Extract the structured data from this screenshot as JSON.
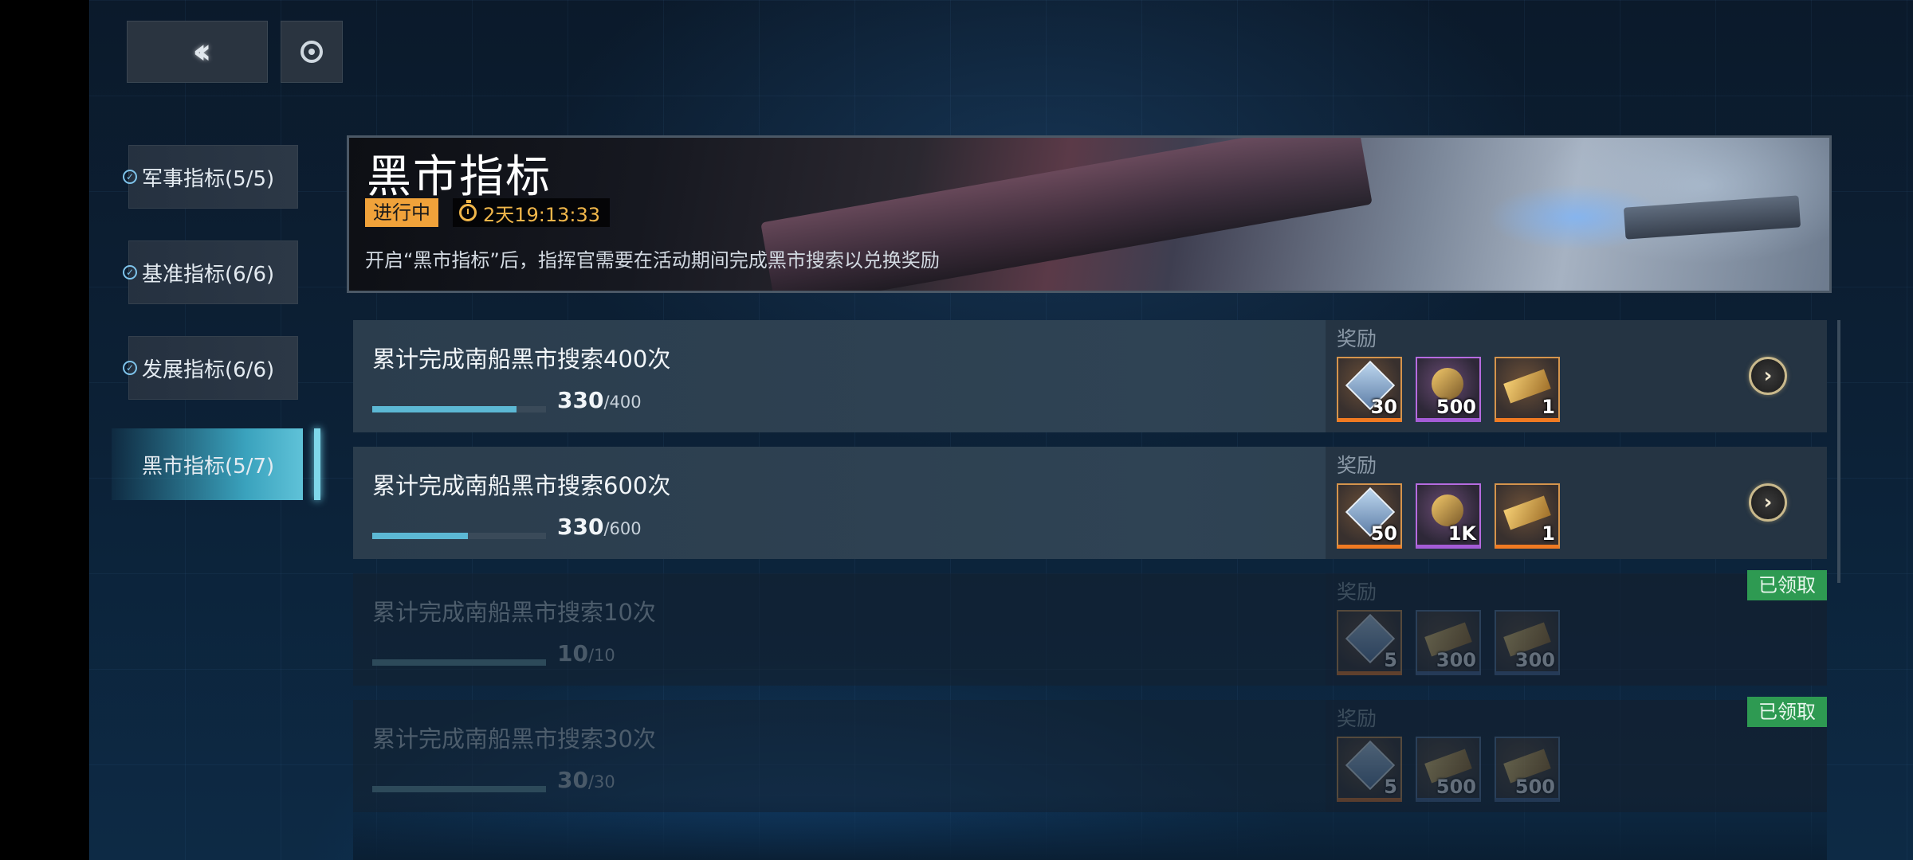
{
  "nav": {
    "back_icon": "double-chevron-left-icon",
    "refresh_icon": "refresh-ring-icon"
  },
  "sidebar": {
    "items": [
      {
        "label": "军事指标(5/5)",
        "checked": true,
        "active": false
      },
      {
        "label": "基准指标(6/6)",
        "checked": true,
        "active": false
      },
      {
        "label": "发展指标(6/6)",
        "checked": true,
        "active": false
      },
      {
        "label": "黑市指标(5/7)",
        "checked": false,
        "active": true
      }
    ]
  },
  "banner": {
    "title": "黑市指标",
    "status": "进行中",
    "timer": "2天19:13:33",
    "description": "开启“黑市指标”后，指挥官需要在活动期间完成黑市搜索以兑换奖励"
  },
  "reward_label": "奖励",
  "claimed_label": "已领取",
  "tasks": [
    {
      "title": "累计完成南船黑市搜索400次",
      "progress": "330",
      "progress_max": "/400",
      "fraction": 0.825,
      "state": "in_progress",
      "rewards": [
        {
          "icon": "gem-chip-icon",
          "count": "30",
          "rarity": "orange"
        },
        {
          "icon": "gold-ore-icon",
          "count": "500",
          "rarity": "purple"
        },
        {
          "icon": "cannon-part-icon",
          "count": "1",
          "rarity": "orange"
        }
      ]
    },
    {
      "title": "累计完成南船黑市搜索600次",
      "progress": "330",
      "progress_max": "/600",
      "fraction": 0.55,
      "state": "in_progress",
      "rewards": [
        {
          "icon": "gem-chip-icon",
          "count": "50",
          "rarity": "orange"
        },
        {
          "icon": "gold-ore-icon",
          "count": "1K",
          "rarity": "purple"
        },
        {
          "icon": "cannon-part-icon",
          "count": "1",
          "rarity": "orange"
        }
      ]
    },
    {
      "title": "累计完成南船黑市搜索10次",
      "progress": "10",
      "progress_max": "/10",
      "fraction": 1.0,
      "state": "claimed",
      "rewards": [
        {
          "icon": "gem-chip-icon",
          "count": "5",
          "rarity": "orange"
        },
        {
          "icon": "ore-icon",
          "count": "300",
          "rarity": "blue"
        },
        {
          "icon": "alloy-icon",
          "count": "300",
          "rarity": "blue"
        }
      ]
    },
    {
      "title": "累计完成南船黑市搜索30次",
      "progress": "30",
      "progress_max": "/30",
      "fraction": 1.0,
      "state": "claimed",
      "rewards": [
        {
          "icon": "gem-chip-icon",
          "count": "5",
          "rarity": "orange"
        },
        {
          "icon": "ore-icon",
          "count": "500",
          "rarity": "blue"
        },
        {
          "icon": "alloy-icon",
          "count": "500",
          "rarity": "blue"
        }
      ]
    }
  ],
  "colors": {
    "accent": "#5cb8d4",
    "status_badge": "#f0a23a",
    "claimed": "#2e9a52",
    "rare_orange": "#f07a22",
    "rare_purple": "#a45cd6"
  }
}
